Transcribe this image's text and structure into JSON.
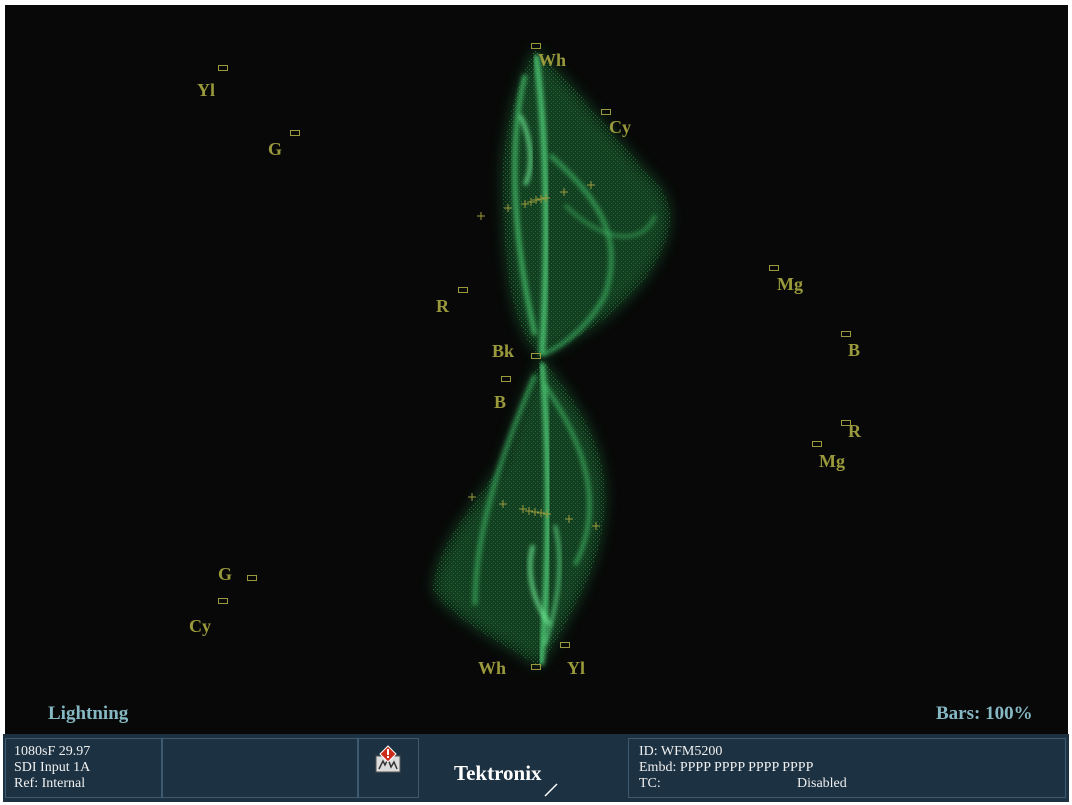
{
  "display": {
    "mode_label": "Lightning",
    "bars_label": "Bars: 100%"
  },
  "targets_upper": {
    "wh": "Wh",
    "cy": "Cy",
    "yl": "Yl",
    "g": "G",
    "r": "R",
    "mg": "Mg",
    "b": "B",
    "bk": "Bk"
  },
  "targets_lower": {
    "b": "B",
    "r": "R",
    "mg": "Mg",
    "g": "G",
    "cy": "Cy",
    "wh": "Wh",
    "yl": "Yl"
  },
  "status": {
    "format": "1080sF 29.97",
    "input": "SDI Input 1A",
    "ref": "Ref: Internal",
    "brand": "Tektronix",
    "id": "ID: WFM5200",
    "embd": "Embd: PPPP PPPP PPPP PPPP",
    "tc_label": "TC:",
    "tc_value": "Disabled"
  },
  "colors": {
    "trace": "#4fdc78",
    "graticule": "#9a9a3c",
    "mode_text": "#86b8c4",
    "status_bg": "#1c3142",
    "alarm_red": "#cc2a1a"
  },
  "icons": {
    "alarm": "alarm-warning-icon"
  }
}
